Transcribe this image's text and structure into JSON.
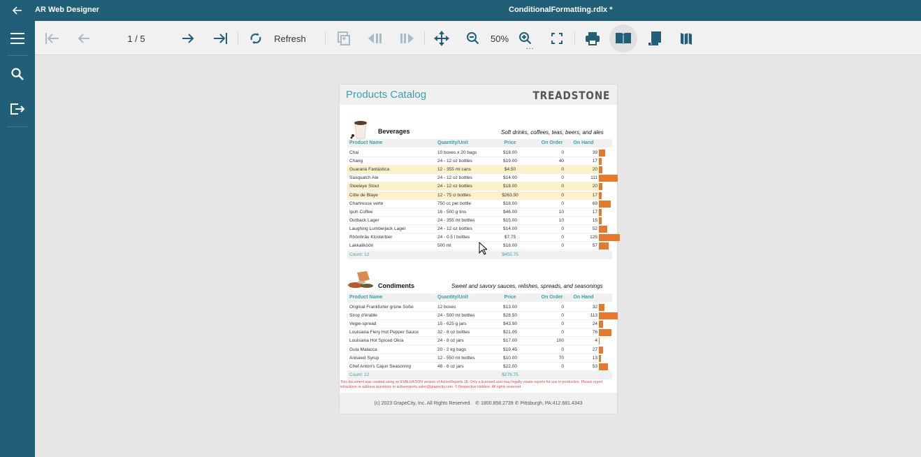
{
  "titlebar": {
    "app_name": "AR Web Designer",
    "document_name": "ConditionalFormatting.rdlx *"
  },
  "toolbar": {
    "page_info": "1 / 5",
    "refresh_label": "Refresh",
    "zoom_value": "50%",
    "zoom_more": "..."
  },
  "report": {
    "title": "Products Catalog",
    "logo": "TREADSTONE",
    "columns": [
      "Product Name",
      "Quantity/Unit",
      "Price",
      "On Order",
      "On Hand"
    ],
    "categories": [
      {
        "name": "Beverages",
        "description": "Soft drinks, coffees, teas, beers, and ales",
        "image": "coffee-cup",
        "rows": [
          {
            "name": "Chai",
            "qty": "10 boxes x 20 bags",
            "price": "$18.00",
            "on_order": "0",
            "on_hand": 39,
            "highlight": false
          },
          {
            "name": "Chang",
            "qty": "24 - 12 oz bottles",
            "price": "$19.00",
            "on_order": "40",
            "on_hand": 17,
            "highlight": false
          },
          {
            "name": "Guaraná Fantástica",
            "qty": "12 - 355 ml cans",
            "price": "$4.50",
            "on_order": "0",
            "on_hand": 20,
            "highlight": true
          },
          {
            "name": "Sasquatch Ale",
            "qty": "24 - 12 oz bottles",
            "price": "$14.00",
            "on_order": "0",
            "on_hand": 111,
            "highlight": false
          },
          {
            "name": "Steeleye Stout",
            "qty": "24 - 12 oz bottles",
            "price": "$18.00",
            "on_order": "0",
            "on_hand": 20,
            "highlight": true
          },
          {
            "name": "Côte de Blaye",
            "qty": "12 - 75 cl bottles",
            "price": "$263.50",
            "on_order": "0",
            "on_hand": 17,
            "highlight": true
          },
          {
            "name": "Chartreuse verte",
            "qty": "750 cc per bottle",
            "price": "$18.00",
            "on_order": "0",
            "on_hand": 69,
            "highlight": false
          },
          {
            "name": "Ipoh Coffee",
            "qty": "16 - 500 g tins",
            "price": "$46.00",
            "on_order": "10",
            "on_hand": 17,
            "highlight": false
          },
          {
            "name": "Outback Lager",
            "qty": "24 - 355 ml bottles",
            "price": "$15.00",
            "on_order": "10",
            "on_hand": 15,
            "highlight": false
          },
          {
            "name": "Laughing Lumberjack Lager",
            "qty": "24 - 12 oz bottles",
            "price": "$14.00",
            "on_order": "0",
            "on_hand": 52,
            "highlight": false
          },
          {
            "name": "Rhönbräu Klosterbier",
            "qty": "24 - 0.5 l bottles",
            "price": "$7.75",
            "on_order": "0",
            "on_hand": 125,
            "highlight": false
          },
          {
            "name": "Lakkalikööri",
            "qty": "500 ml",
            "price": "$18.00",
            "on_order": "0",
            "on_hand": 57,
            "highlight": false
          }
        ],
        "count": "Count: 12",
        "total": "$455.75"
      },
      {
        "name": "Condiments",
        "description": "Sweet and savory sauces, relishes, spreads, and seasonings",
        "image": "spices",
        "rows": [
          {
            "name": "Original Frankfurter grüne Soße",
            "qty": "12 boxes",
            "price": "$13.00",
            "on_order": "0",
            "on_hand": 32,
            "highlight": false
          },
          {
            "name": "Sirop d'érable",
            "qty": "24 - 500 ml bottles",
            "price": "$28.50",
            "on_order": "0",
            "on_hand": 113,
            "highlight": false
          },
          {
            "name": "Vegie-spread",
            "qty": "15 - 625 g jars",
            "price": "$43.90",
            "on_order": "0",
            "on_hand": 24,
            "highlight": false
          },
          {
            "name": "Louisiana Fiery Hot Pepper Sauce",
            "qty": "32 - 8 oz bottles",
            "price": "$21.05",
            "on_order": "0",
            "on_hand": 76,
            "highlight": false
          },
          {
            "name": "Louisiana Hot Spiced Okra",
            "qty": "24 - 8 oz jars",
            "price": "$17.00",
            "on_order": "100",
            "on_hand": 4,
            "highlight": false
          },
          {
            "name": "Gula Malacca",
            "qty": "20 - 2 kg bags",
            "price": "$19.45",
            "on_order": "0",
            "on_hand": 27,
            "highlight": false
          },
          {
            "name": "Aniseed Syrup",
            "qty": "12 - 550 ml bottles",
            "price": "$10.00",
            "on_order": "70",
            "on_hand": 13,
            "highlight": false
          },
          {
            "name": "Chef Anton's Cajun Seasoning",
            "qty": "48 - 6 oz jars",
            "price": "$22.00",
            "on_order": "0",
            "on_hand": 53,
            "highlight": false
          }
        ],
        "count": "Count: 12",
        "total": "$276.75"
      }
    ],
    "bar_max_value": 125,
    "eval_notice": "This document was created using an EVALUATION version of ActiveReports 18. Only a licensed user may legally create reports for use in production. Please report infractions or address questions to activereports.sales@grapecity.com. © Respective Holders. All rights reserved.",
    "footer_copyright": "(c) 2023 GrapeCity, Inc. All Rights Reserved.",
    "footer_phone1": "1800.858.2739",
    "footer_phone2": "Pittsburgh, PA:412.681.4343"
  },
  "colors": {
    "brand": "#215f78",
    "accent_teal": "#3ba0a8",
    "bar_orange": "#e8792a",
    "highlight_row": "#fdf1c9"
  }
}
